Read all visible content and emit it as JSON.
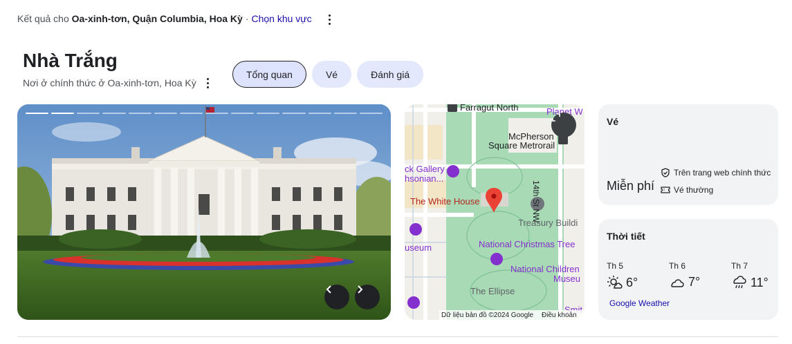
{
  "results": {
    "prefix": "Kết quả cho",
    "location": "Oa-xinh-tơn, Quận Columbia, Hoa Kỳ",
    "separator": "·",
    "change_region": "Chọn khu vực"
  },
  "entity": {
    "title": "Nhà Trắng",
    "subtitle": "Nơi ở chính thức ở Oa-xinh-tơn, Hoa Kỳ"
  },
  "tabs": [
    {
      "label": "Tổng quan",
      "active": true
    },
    {
      "label": "Vé",
      "active": false
    },
    {
      "label": "Đánh giá",
      "active": false
    }
  ],
  "gallery": {
    "current_index": 1,
    "total": 14
  },
  "map": {
    "labels": {
      "farragut": "Farragut North",
      "planet": "Planet W",
      "mcpherson_1": "McPherson",
      "mcpherson_2": "Square Metrorail",
      "gallery_1": "ck Gallery",
      "gallery_2": "hsonian...",
      "street": "14th St NW",
      "whitehouse": "The White House",
      "treasury": "Treasury Buildi",
      "museum": "useum",
      "christmas": "National Christmas Tree",
      "children_1": "National Children",
      "children_2": "Museu",
      "ellipse": "The Ellipse",
      "smit": "Smit"
    },
    "footer_data": "Dữ liệu bản đồ ©2024 Google",
    "footer_terms": "Điều khoản",
    "colors": {
      "park": "#a8dab5",
      "land": "#f1efe9",
      "road": "#ffffff",
      "label_red": "#b3261e",
      "label_purple": "#8430ce"
    }
  },
  "tickets": {
    "title": "Vé",
    "price": "Miễn phí",
    "features": [
      {
        "icon": "shield-check-icon",
        "text": "Trên trang web chính thức"
      },
      {
        "icon": "ticket-icon",
        "text": "Vé thường"
      }
    ]
  },
  "weather": {
    "title": "Thời tiết",
    "days": [
      {
        "name": "Th 5",
        "temp": "6°",
        "icon": "sun-cloud-icon"
      },
      {
        "name": "Th 6",
        "temp": "7°",
        "icon": "cloud-icon"
      },
      {
        "name": "Th 7",
        "temp": "11°",
        "icon": "rain-cloud-icon"
      }
    ],
    "source": "Google Weather"
  }
}
